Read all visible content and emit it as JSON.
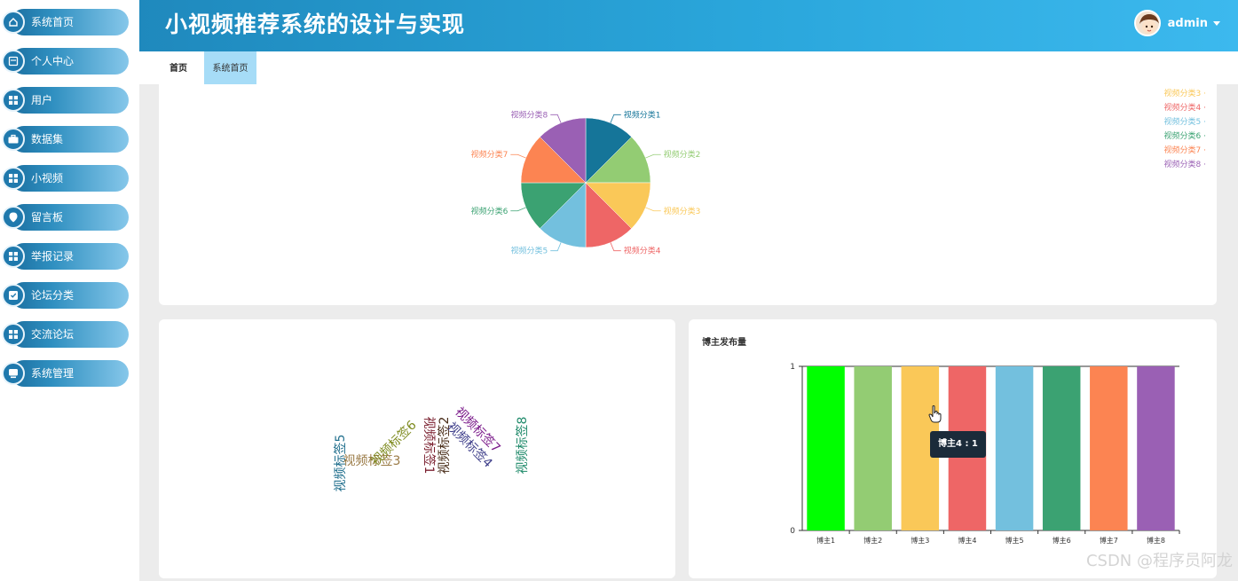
{
  "app": {
    "title": "小视频推荐系统的设计与实现"
  },
  "user": {
    "name": "admin"
  },
  "sidebar": {
    "items": [
      {
        "label": "系统首页",
        "icon": "home-icon"
      },
      {
        "label": "个人中心",
        "icon": "profile-icon"
      },
      {
        "label": "用户",
        "icon": "grid-icon"
      },
      {
        "label": "数据集",
        "icon": "briefcase-icon"
      },
      {
        "label": "小视频",
        "icon": "grid-icon"
      },
      {
        "label": "留言板",
        "icon": "pin-icon"
      },
      {
        "label": "举报记录",
        "icon": "grid-icon"
      },
      {
        "label": "论坛分类",
        "icon": "checklist-icon"
      },
      {
        "label": "交流论坛",
        "icon": "grid-icon"
      },
      {
        "label": "系统管理",
        "icon": "monitor-icon"
      }
    ]
  },
  "tabs": [
    {
      "label": "首页",
      "active": false
    },
    {
      "label": "系统首页",
      "active": true
    }
  ],
  "colors": {
    "accent": "#2aa6db",
    "sidebar_pill": "#1b6fa0",
    "palette": [
      "#157599",
      "#93cc73",
      "#fac858",
      "#ee6666",
      "#73c0de",
      "#3ba272",
      "#fc8452",
      "#9a60b4"
    ]
  },
  "pie_chart": {
    "legend": [
      "视频分类3",
      "视频分类4",
      "视频分类5",
      "视频分类6",
      "视频分类7",
      "视频分类8"
    ],
    "legend_placement": "top-right"
  },
  "word_cloud": {
    "words": [
      {
        "text": "视频标签5",
        "color": "#1f6e8c"
      },
      {
        "text": "视频标签3",
        "color": "#9a7a45"
      },
      {
        "text": "视频标签6",
        "color": "#7d8a1e"
      },
      {
        "text": "视频标签1",
        "color": "#7a1f2e"
      },
      {
        "text": "视频标签2",
        "color": "#4a2e1a"
      },
      {
        "text": "视频标签4",
        "color": "#3e3e8a"
      },
      {
        "text": "视频标签7",
        "color": "#7a1a8a"
      },
      {
        "text": "视频标签8",
        "color": "#1f8a6a"
      }
    ]
  },
  "bar_chart": {
    "title": "博主发布量",
    "tooltip": "博主4 : 1"
  },
  "watermark": "CSDN @程序员阿龙",
  "chart_data": [
    {
      "type": "pie",
      "labels": [
        "视频分类1",
        "视频分类2",
        "视频分类3",
        "视频分类4",
        "视频分类5",
        "视频分类6",
        "视频分类7",
        "视频分类8"
      ],
      "values": [
        1,
        1,
        1,
        1,
        1,
        1,
        1,
        1
      ],
      "legend": [
        "视频分类3",
        "视频分类4",
        "视频分类5",
        "视频分类6",
        "视频分类7",
        "视频分类8"
      ]
    },
    {
      "type": "bar",
      "title": "博主发布量",
      "categories": [
        "博主1",
        "博主2",
        "博主3",
        "博主4",
        "博主5",
        "博主6",
        "博主7",
        "博主8"
      ],
      "values": [
        1,
        1,
        1,
        1,
        1,
        1,
        1,
        1
      ],
      "bar_colors": [
        "#00ff00",
        "#93cc73",
        "#fac858",
        "#ee6666",
        "#73c0de",
        "#3ba272",
        "#fc8452",
        "#9a60b4"
      ],
      "ylim": [
        0,
        1
      ],
      "yticks": [
        "0",
        "1"
      ],
      "grid": false
    }
  ]
}
